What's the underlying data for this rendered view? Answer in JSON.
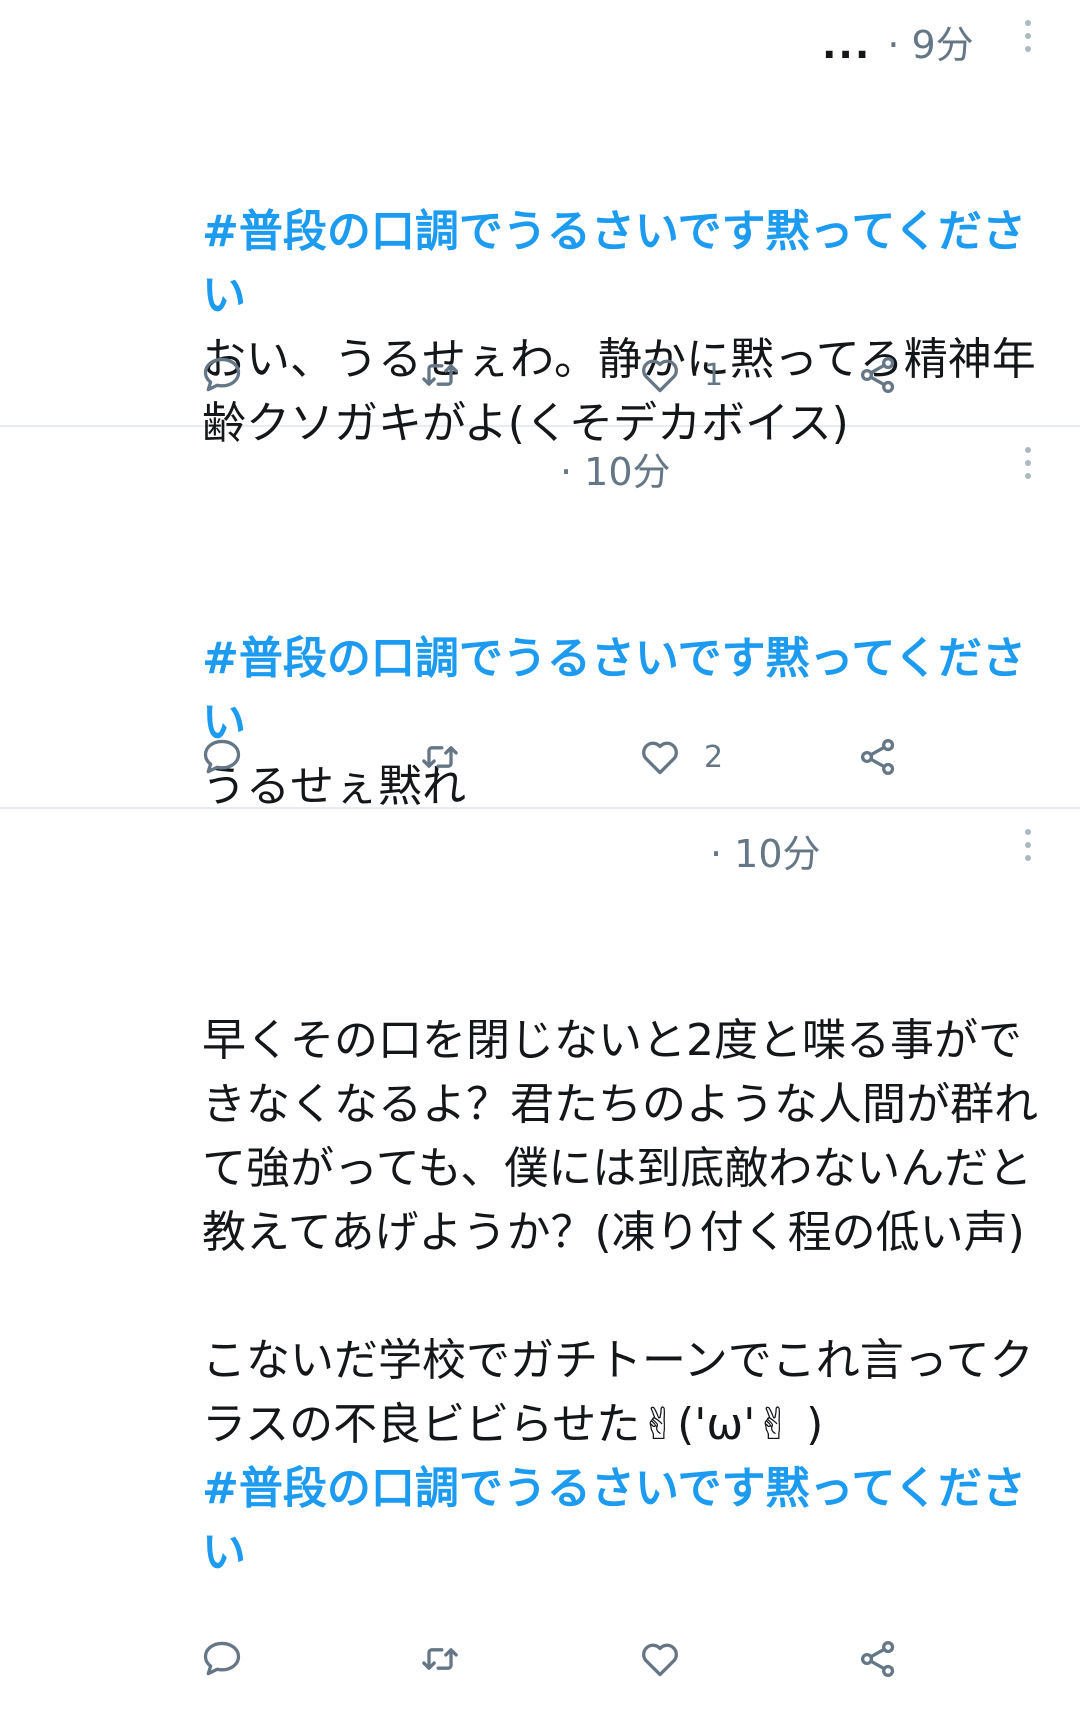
{
  "tweets": [
    {
      "ellipsis": "...",
      "time": "· 9分",
      "hashtag": "#普段の口調でうるさいです黙ってください",
      "text": "おい、うるせぇわ。静かに黙ってろ精神年齢クソガキがよ(くそデカボイス)",
      "likes": "1"
    },
    {
      "time": "· 10分",
      "hashtag": "#普段の口調でうるさいです黙ってください",
      "text": "うるせぇ黙れ",
      "likes": "2"
    },
    {
      "time": "· 10分",
      "text": "早くその口を閉じないと2度と喋る事ができなくなるよ？君たちのような人間が群れて強がっても、僕には到底敵わないんだと教えてあげようか？(凍り付く程の低い声)\n\nこないだ学校でガチトーンでこれ言ってクラスの不良ビビらせた✌('ω'✌ )\n",
      "hashtag": "#普段の口調でうるさいです黙ってください",
      "likes": ""
    }
  ],
  "icons": {
    "reply": "reply-icon",
    "retweet": "retweet-icon",
    "like": "heart-icon",
    "share": "share-icon",
    "more": "more-vertical-icon"
  },
  "colors": {
    "hashtag": "#1d9bf0",
    "muted": "#657786",
    "icon": "#657786",
    "divider": "#e6ecf0"
  }
}
